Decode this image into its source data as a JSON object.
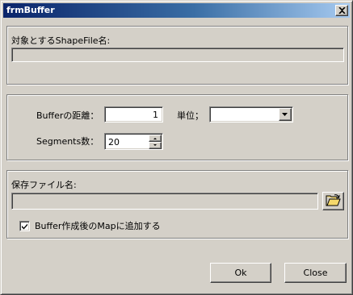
{
  "window": {
    "title": "frmBuffer",
    "close_icon": "close-icon"
  },
  "source_group": {
    "label": "対象とするShapeFile名:",
    "value": ""
  },
  "buffer_group": {
    "distance_label": "Bufferの距離：",
    "distance_value": "1",
    "unit_label": "単位；",
    "unit_value": "",
    "segments_label": "Segments数：",
    "segments_value": "20"
  },
  "output_group": {
    "label": "保存ファイル名:",
    "value": "",
    "browse_icon": "folder-open-icon",
    "add_to_map_label": "Buffer作成後のMapに追加する",
    "add_to_map_checked": true
  },
  "buttons": {
    "ok_label": "Ok",
    "close_label": "Close"
  }
}
